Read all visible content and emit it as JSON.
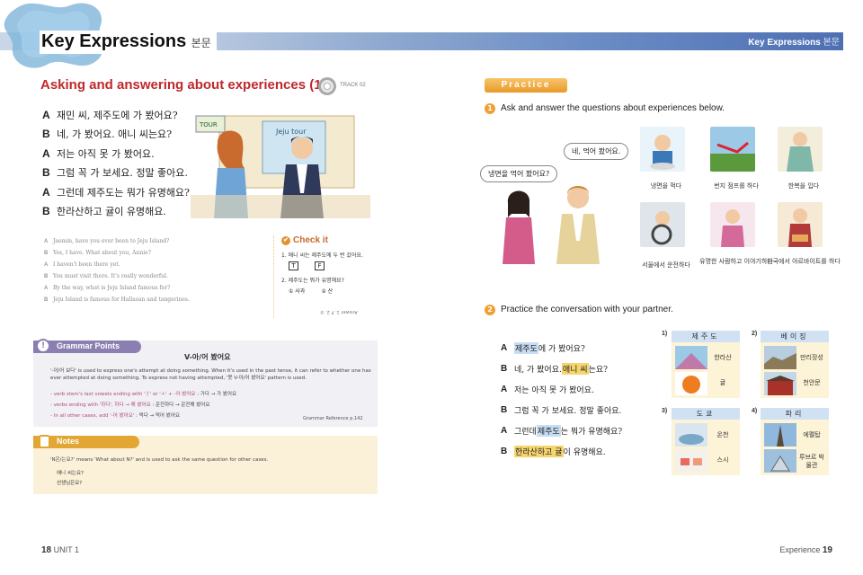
{
  "header": {
    "title": "Key Expressions",
    "title_sub": "본문",
    "right_title": "Key Expressions",
    "right_sub": "본문"
  },
  "lesson": {
    "title": "Asking and answering about experiences (1)",
    "track": "TRACK 02"
  },
  "dialog": [
    {
      "speaker": "A",
      "text": "재민 씨, 제주도에 가 봤어요?"
    },
    {
      "speaker": "B",
      "text": "네, 가 봤어요. 애니 씨는요?"
    },
    {
      "speaker": "A",
      "text": "저는 아직 못 가 봤어요."
    },
    {
      "speaker": "B",
      "text": "그럼 꼭 가 보세요. 정말 좋아요."
    },
    {
      "speaker": "A",
      "text": "그런데 제주도는 뭐가 유명해요?"
    },
    {
      "speaker": "B",
      "text": "한라산하고 귤이 유명해요."
    }
  ],
  "scene": {
    "sign1": "TOUR",
    "sign2": "Jeju tour"
  },
  "translation": [
    {
      "speaker": "A",
      "text": "Jaemin, have you ever been to Jeju Island?"
    },
    {
      "speaker": "B",
      "text": "Yes, I have. What about you, Annie?"
    },
    {
      "speaker": "A",
      "text": "I haven't been there yet."
    },
    {
      "speaker": "B",
      "text": "You must visit there. It's really wonderful."
    },
    {
      "speaker": "A",
      "text": "By the way, what is Jeju Island famous for?"
    },
    {
      "speaker": "B",
      "text": "Jeju Island is famous for Hallasan and tangerines."
    }
  ],
  "check_it": {
    "title": "Check it",
    "q1": "1. 애니 씨는 제주도에 두 번 갔어요.",
    "q1_opt_t": "T",
    "q1_opt_f": "F",
    "q2": "2. 제주도는 뭐가 유명해요?",
    "q2_opt1": "① 사과",
    "q2_opt2": "② 산",
    "answer": "Answer 1. F 2. ②"
  },
  "grammar": {
    "label": "Grammar Points",
    "heading": "V-아/어 봤어요",
    "body": "'-아/어 보다' is used to express one's attempt at doing something. When it's used in the past tense, it can refer to whether one has ever attempted at doing something. To express not having attempted, '못 V-아/어 봤어요' pattern is used.",
    "rule1_label": "- verb stem's last vowels ending with 'ㅏ' or 'ㅗ' + -아 봤어요",
    "rule1_example": ": 가다 → 가 봤어요",
    "rule2_label": "- verbs ending with '하다', 하다 → 해 봤어요",
    "rule2_example": ": 운전하다 → 운전해 봤어요",
    "rule3_label": "- In all other cases, add '-어 봤어요'",
    "rule3_example": ": 먹다 → 먹어 봤어요",
    "reference": "Grammar Reference p.142"
  },
  "notes": {
    "label": "Notes",
    "body": "'N은/는요?' means 'What about N?' and is used to ask the same question for other cases.",
    "ex1": "애니 씨는요?",
    "ex2": "선생님은요?"
  },
  "practice": {
    "tag": "Practice",
    "instr1": "Ask and answer the questions about experiences below.",
    "bubble_q": "냉면을 먹어 봤어요?",
    "bubble_a": "네, 먹어 봤어요.",
    "activities": [
      {
        "label": "냉면을 먹다"
      },
      {
        "label": "번지 점프를 하다"
      },
      {
        "label": "한복을 입다"
      },
      {
        "label": "서울에서 운전하다"
      },
      {
        "label": "유명한 사람하고 이야기하다"
      },
      {
        "label": "한국에서 아르바이트를 하다"
      }
    ],
    "instr2": "Practice the conversation with your partner."
  },
  "pair_dialog": [
    {
      "speaker": "A",
      "pre": "",
      "hl": "제주도",
      "post": "에 가 봤어요?",
      "style": "blue"
    },
    {
      "speaker": "B",
      "pre": "네, 가 봤어요. ",
      "hl": "애니 씨",
      "post": "는요?",
      "style": "yellow"
    },
    {
      "speaker": "A",
      "pre": "저는 아직 못 가 봤어요.",
      "hl": "",
      "post": "",
      "style": ""
    },
    {
      "speaker": "B",
      "pre": "그럼 꼭 가 보세요. 정말 좋아요.",
      "hl": "",
      "post": "",
      "style": ""
    },
    {
      "speaker": "A",
      "pre": "그런데 ",
      "hl": "제주도",
      "post": "는 뭐가 유명해요?",
      "style": "blue"
    },
    {
      "speaker": "B",
      "pre": "",
      "hl": "한라산하고 귤",
      "post": "이 유명해요.",
      "style": "yellow"
    }
  ],
  "panels": [
    {
      "num": "1)",
      "place": "제주도",
      "item1": "한라산",
      "item2": "귤"
    },
    {
      "num": "2)",
      "place": "베이징",
      "item1": "만리장성",
      "item2": "천안문"
    },
    {
      "num": "3)",
      "place": "도쿄",
      "item1": "온천",
      "item2": "스시"
    },
    {
      "num": "4)",
      "place": "파리",
      "item1": "에펠탑",
      "item2": "루브르 박물관"
    }
  ],
  "folio": {
    "left_num": "18",
    "left_text": "UNIT 1",
    "right_text": "Experience",
    "right_num": "19"
  }
}
